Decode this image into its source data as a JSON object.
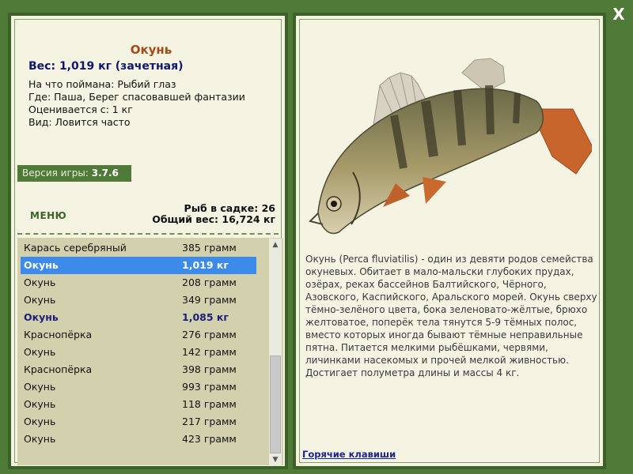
{
  "fish": {
    "name": "Окунь",
    "weight": "Вес: 1,019 кг (зачетная)",
    "bait": "На что поймана: Рыбий глаз",
    "place": "Где: Паша, Берег спасовавшей фантазии",
    "rating": "Оценивается с: 1 кг",
    "kind": "Вид: Ловится часто"
  },
  "version": {
    "label": "Версия игры:",
    "value": "3.7.6"
  },
  "menu_label": "МЕНЮ",
  "stats": {
    "count": "Рыб в садке: 26",
    "total": "Общий вес: 16,724 кг"
  },
  "catches": [
    {
      "name": "Карась серебряный",
      "weight": "385 грамм"
    },
    {
      "name": "Окунь",
      "weight": "1,019 кг"
    },
    {
      "name": "Окунь",
      "weight": "208 грамм"
    },
    {
      "name": "Окунь",
      "weight": "349 грамм"
    },
    {
      "name": "Окунь",
      "weight": "1,085 кг"
    },
    {
      "name": "Краснопёрка",
      "weight": "276 грамм"
    },
    {
      "name": "Окунь",
      "weight": "142 грамм"
    },
    {
      "name": "Краснопёрка",
      "weight": "398 грамм"
    },
    {
      "name": "Окунь",
      "weight": "993 грамм"
    },
    {
      "name": "Окунь",
      "weight": "118 грамм"
    },
    {
      "name": "Окунь",
      "weight": "217 грамм"
    },
    {
      "name": "Окунь",
      "weight": "423 грамм"
    }
  ],
  "selected_index": 1,
  "description": "Окунь (Perca fluviatilis) - один из девяти родов семейства окуневых. Обитает в мало-мальски глубоких прудах, озёрах, реках бассейнов Балтийского, Чёрного, Азовского, Каспийского, Аральского морей. Окунь сверху тёмно-зелёного цвета, бока зеленовато-жёлтые, брюхо желтоватое, поперёк тела тянутся 5-9 тёмных полос, вместо которых иногда бывают тёмные неправильные пятна. Питается мелкими рыбёшками, червями, личинками насекомых и прочей мелкой живностью. Достигает полуметра длины и массы 4 кг.",
  "hotkeys_label": "Горячие клавиши",
  "close_glyph": "X",
  "scroll_up_glyph": "▲",
  "scroll_down_glyph": "▼",
  "colors": {
    "background": "#4f7a37",
    "panel": "#f5f3e2",
    "list_bg": "#d3d0ae",
    "selection": "#3c8ae9",
    "fish_name": "#a14b15",
    "weight_text": "#10186a"
  }
}
